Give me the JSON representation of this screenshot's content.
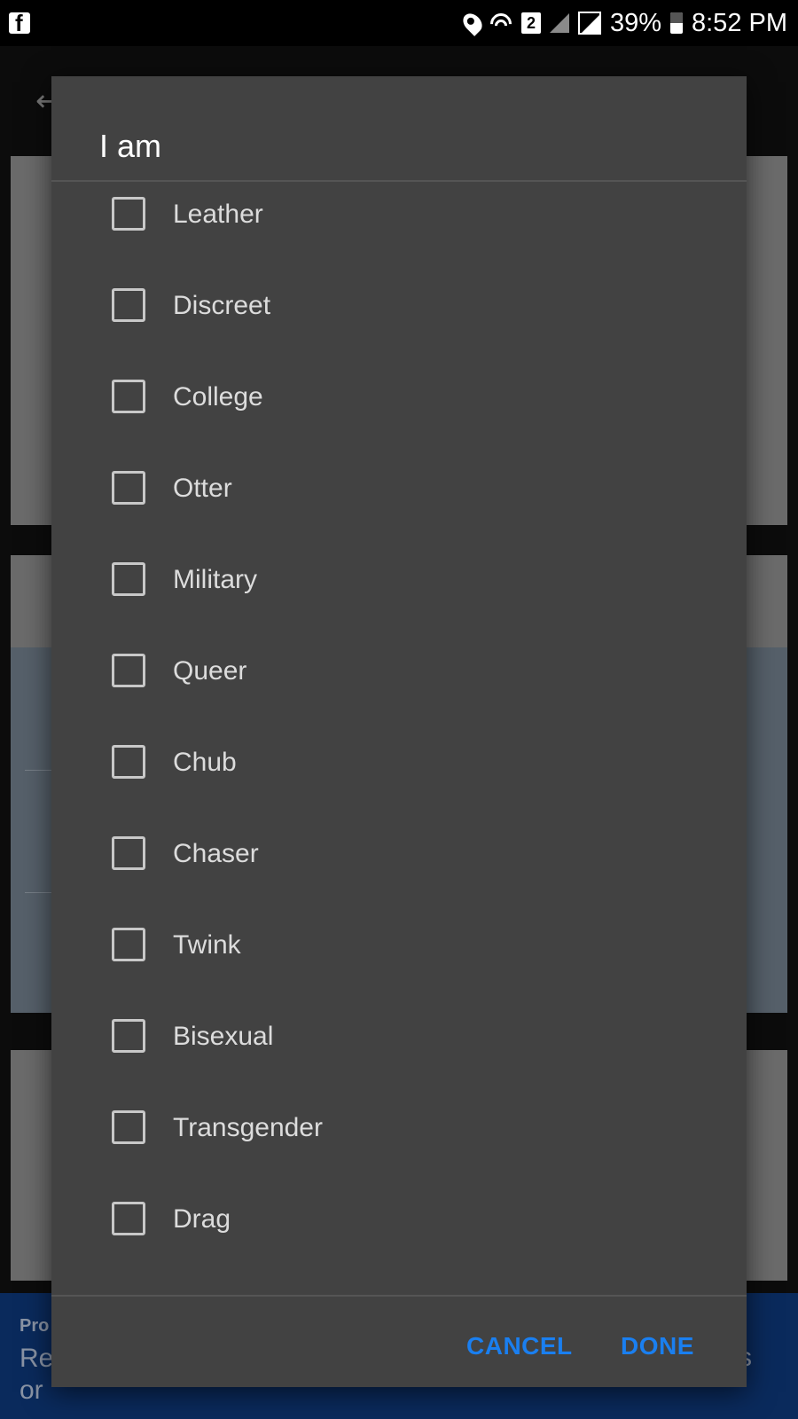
{
  "status_bar": {
    "app_icon": "facebook-icon",
    "icons": [
      "location-icon",
      "wifi-icon",
      "sim-2-icon",
      "signal-icon",
      "signal-full-icon"
    ],
    "battery_percent": "39%",
    "time": "8:52 PM"
  },
  "background": {
    "back_icon": "back-arrow-icon",
    "banner": {
      "title": "Pro",
      "text": "Re\nor",
      "right_text": "ls"
    }
  },
  "dialog": {
    "title": "I am",
    "options": [
      {
        "label": "Leather",
        "checked": false
      },
      {
        "label": "Discreet",
        "checked": false
      },
      {
        "label": "College",
        "checked": false
      },
      {
        "label": "Otter",
        "checked": false
      },
      {
        "label": "Military",
        "checked": false
      },
      {
        "label": "Queer",
        "checked": false
      },
      {
        "label": "Chub",
        "checked": false
      },
      {
        "label": "Chaser",
        "checked": false
      },
      {
        "label": "Twink",
        "checked": false
      },
      {
        "label": "Bisexual",
        "checked": false
      },
      {
        "label": "Transgender",
        "checked": false
      },
      {
        "label": "Drag",
        "checked": false
      }
    ],
    "cancel_label": "CANCEL",
    "done_label": "DONE",
    "accent_color": "#1a7ff0"
  }
}
